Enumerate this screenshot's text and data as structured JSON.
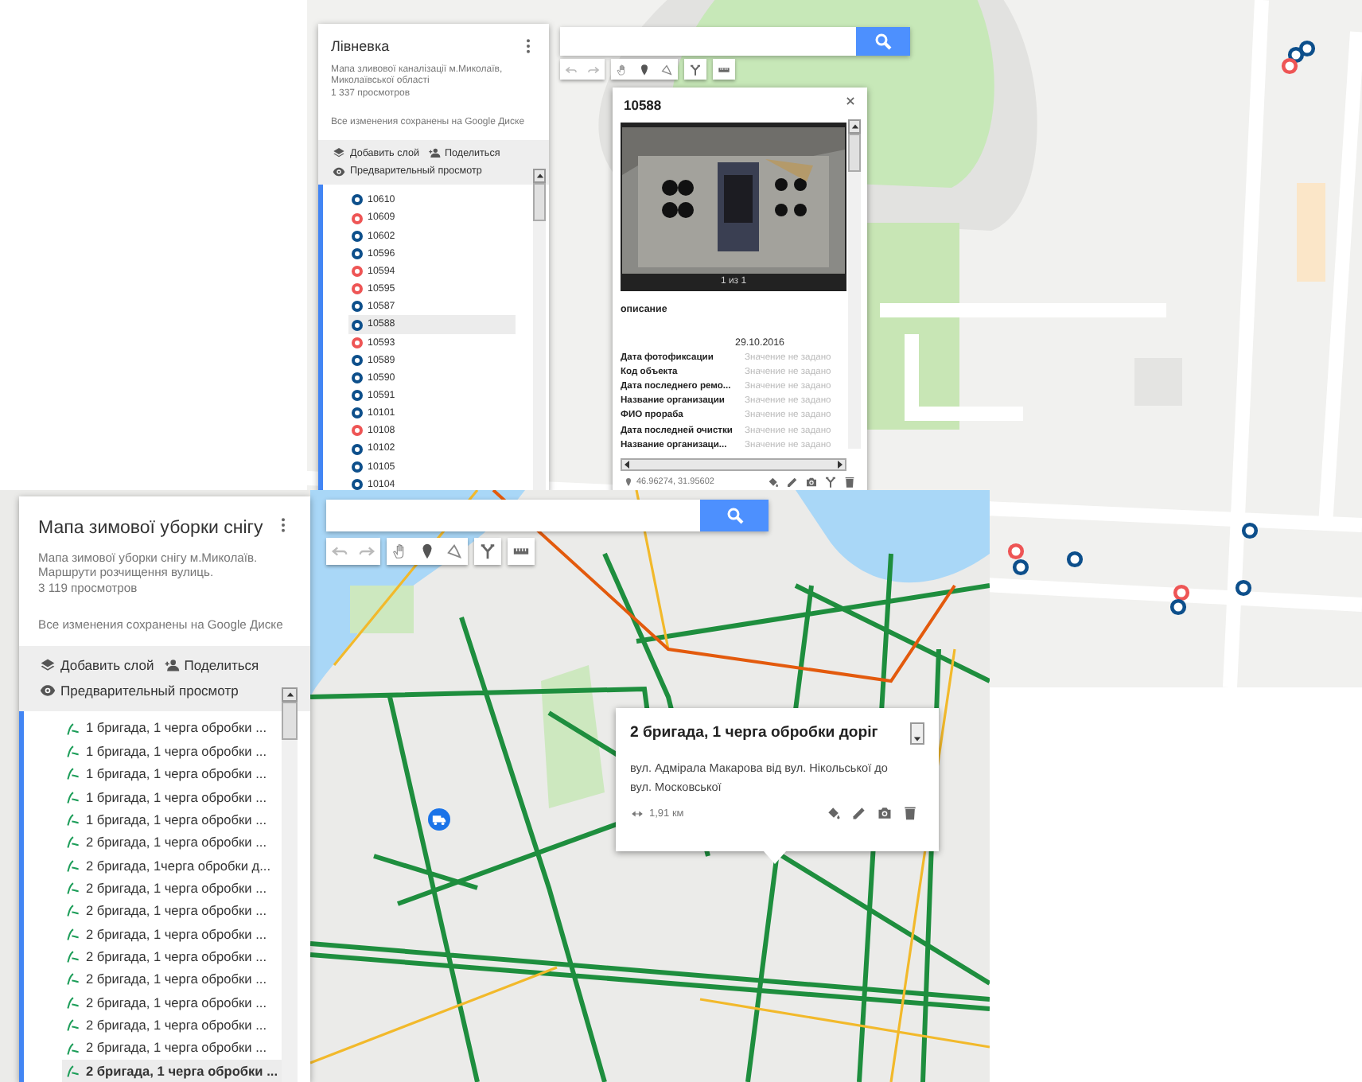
{
  "windows": [
    {
      "panel": {
        "title": "Лiвневка",
        "description": "Мапа зливової каналізації м.Миколаїв, Миколаївської області",
        "views": "1 337 просмотров",
        "save_status": "Все изменения сохранены на Google Диске",
        "actions": [
          {
            "kind": "add-layer",
            "label": "Добавить слой"
          },
          {
            "kind": "share",
            "label": "Поделиться"
          },
          {
            "kind": "preview",
            "label": "Предварительный просмотр"
          }
        ],
        "items": [
          {
            "label": "10610",
            "color": "#0d4f8b",
            "selected": false
          },
          {
            "label": "10609",
            "color": "#ee5555",
            "selected": false
          },
          {
            "label": "10602",
            "color": "#0d4f8b",
            "selected": false
          },
          {
            "label": "10596",
            "color": "#0d4f8b",
            "selected": false
          },
          {
            "label": "10594",
            "color": "#ee5555",
            "selected": false
          },
          {
            "label": "10595",
            "color": "#ee5555",
            "selected": false
          },
          {
            "label": "10587",
            "color": "#0d4f8b",
            "selected": false
          },
          {
            "label": "10588",
            "color": "#0d4f8b",
            "selected": true
          },
          {
            "label": "10593",
            "color": "#ee5555",
            "selected": false
          },
          {
            "label": "10589",
            "color": "#0d4f8b",
            "selected": false
          },
          {
            "label": "10590",
            "color": "#0d4f8b",
            "selected": false
          },
          {
            "label": "10591",
            "color": "#0d4f8b",
            "selected": false
          },
          {
            "label": "10101",
            "color": "#0d4f8b",
            "selected": false
          },
          {
            "label": "10108",
            "color": "#ee5555",
            "selected": false
          },
          {
            "label": "10102",
            "color": "#0d4f8b",
            "selected": false
          },
          {
            "label": "10105",
            "color": "#0d4f8b",
            "selected": false
          },
          {
            "label": "10104",
            "color": "#0d4f8b",
            "selected": false
          }
        ]
      },
      "popup": {
        "kind": "point",
        "title": "10588",
        "photo": {
          "kind": "picture",
          "caption": "1 из 1"
        },
        "description_label": "описание",
        "date": "29.10.2016",
        "fields": [
          {
            "label": "Дата фотофиксации",
            "value": "Значение не задано"
          },
          {
            "label": "Код объекта",
            "value": "Значение не задано"
          },
          {
            "label": "Дата последнего ремо...",
            "value": "Значение не задано"
          },
          {
            "label": "Название организации",
            "value": "Значение не задано"
          },
          {
            "label": "ФИО прораба",
            "value": "Значение не задано"
          },
          {
            "label": "Дата последней очистки",
            "value": "Значение не задано"
          },
          {
            "label": "Название организаци...",
            "value": "Значение не задано"
          }
        ],
        "coordinates": "46.96274, 31.95602"
      }
    },
    {
      "panel": {
        "title": "Мапа зимової уборки снігу",
        "description": "Мапа зимової уборки снігу м.Миколаїв. Маршрути розчищення вулиць.",
        "views": "3 119 просмотров",
        "save_status": "Все изменения сохранены на Google Диске",
        "actions": [
          {
            "kind": "add-layer",
            "label": "Добавить слой"
          },
          {
            "kind": "share",
            "label": "Поделиться"
          },
          {
            "kind": "preview",
            "label": "Предварительный просмотр"
          }
        ],
        "items": [
          {
            "label": "1 бригада, 1 черга обробки ...",
            "selected": false
          },
          {
            "label": "1 бригада, 1 черга обробки ...",
            "selected": false
          },
          {
            "label": "1 бригада, 1 черга обробки ...",
            "selected": false
          },
          {
            "label": "1 бригада, 1 черга обробки ...",
            "selected": false
          },
          {
            "label": "1 бригада, 1 черга обробки ...",
            "selected": false
          },
          {
            "label": "2 бригада, 1 черга обробки ...",
            "selected": false
          },
          {
            "label": "2 бригада, 1черга обробки д...",
            "selected": false
          },
          {
            "label": "2 бригада, 1 черга обробки ...",
            "selected": false
          },
          {
            "label": "2 бригада, 1 черга обробки ...",
            "selected": false
          },
          {
            "label": "2 бригада, 1 черга обробки ...",
            "selected": false
          },
          {
            "label": "2 бригада, 1 черга обробки ...",
            "selected": false
          },
          {
            "label": "2 бригада, 1 черга обробки ...",
            "selected": false
          },
          {
            "label": "2 бригада, 1 черга обробки ...",
            "selected": false
          },
          {
            "label": "2 бригада, 1 черга обробки ...",
            "selected": false
          },
          {
            "label": "2 бригада, 1 черга обробки ...",
            "selected": false
          },
          {
            "label": "2 бригада, 1 черга обробки ...",
            "selected": true
          }
        ]
      },
      "popup": {
        "kind": "line",
        "title": "2 бригада, 1 черга обробки доріг",
        "description": "вул. Адмірала Макарова від вул. Нікольської до вул. Московської",
        "length": "1,91 км"
      }
    }
  ]
}
